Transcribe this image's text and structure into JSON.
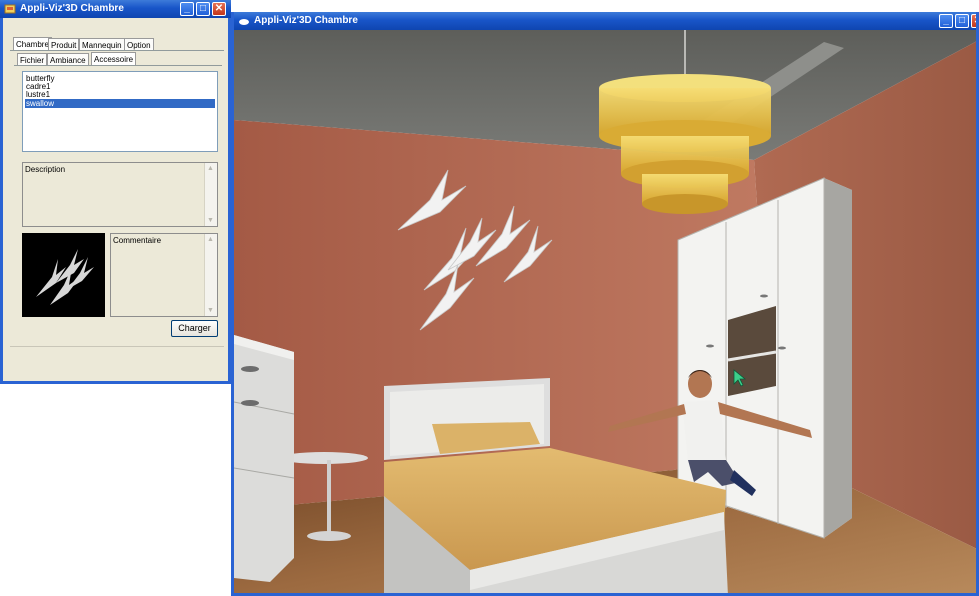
{
  "tool_window": {
    "title": "Appli-Viz'3D Chambre",
    "tabs_top": [
      "Chambre",
      "Produit",
      "Mannequin",
      "Option"
    ],
    "tabs_sub": [
      "Fichier",
      "Ambiance",
      "Accessoire"
    ],
    "selected_top_tab": "Chambre",
    "selected_sub_tab": "Accessoire",
    "accessories": [
      "butterfly",
      "cadre1",
      "lustre1",
      "swallow"
    ],
    "selected_accessory": "swallow",
    "description_label": "Description",
    "comment_label": "Commentaire",
    "load_button": "Charger",
    "preview_icon": "swallow-thumbnail-icon"
  },
  "main_window": {
    "title": "Appli-Viz'3D Chambre",
    "scene_icon": "3d-room-scene",
    "colors": {
      "wall": "#b9725a",
      "ceiling": "#6e6f6c",
      "floor": "#8a5a36",
      "bed_cover": "#d4a85f",
      "lamp": "#e8c24a"
    }
  },
  "colors": {
    "titlebar": "#1855c8",
    "selection": "#316ac5",
    "face": "#ece9d8"
  }
}
